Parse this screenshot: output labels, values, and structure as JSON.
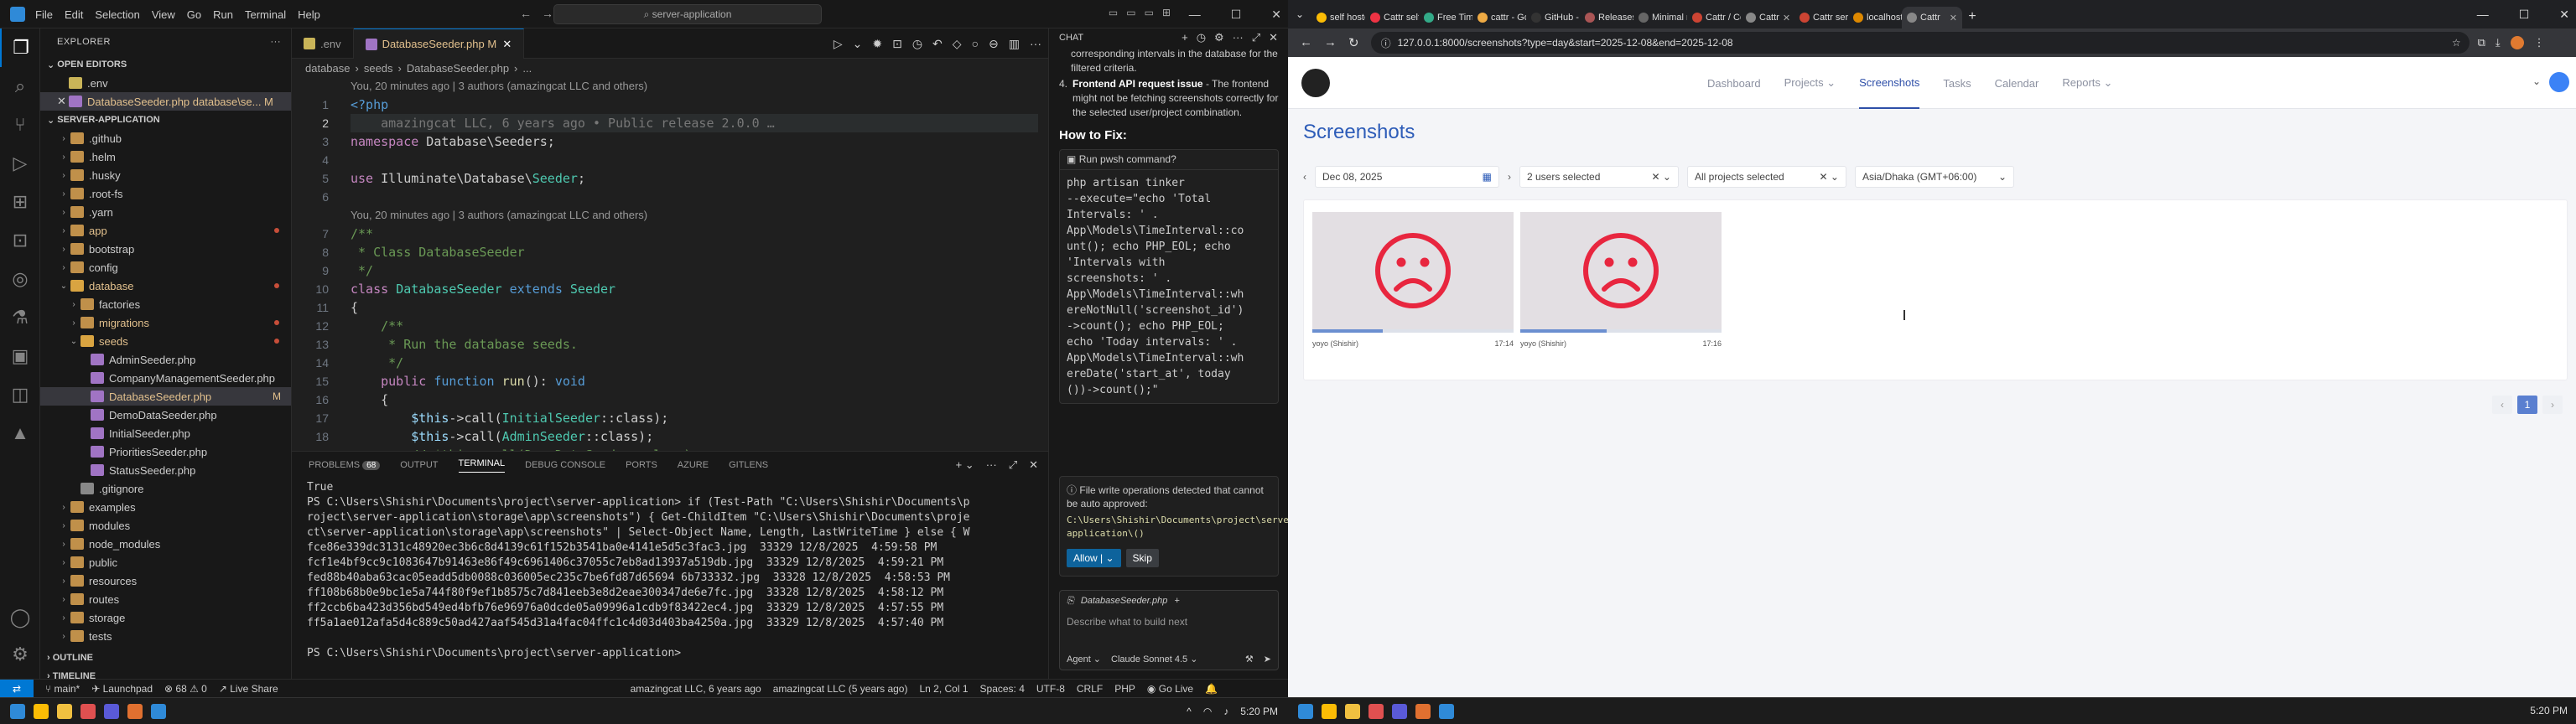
{
  "vscode": {
    "menu": [
      "File",
      "Edit",
      "Selection",
      "View",
      "Go",
      "Run",
      "Terminal",
      "Help"
    ],
    "search": "server-application",
    "explorer_title": "EXPLORER",
    "open_editors": "OPEN EDITORS",
    "open_files": [
      ".env",
      "DatabaseSeeder.php  database\\se...  M"
    ],
    "project": "SERVER-APPLICATION",
    "tree": [
      {
        "label": ".github",
        "depth": 1,
        "type": "folder"
      },
      {
        "label": ".helm",
        "depth": 1,
        "type": "folder"
      },
      {
        "label": ".husky",
        "depth": 1,
        "type": "folder"
      },
      {
        "label": ".root-fs",
        "depth": 1,
        "type": "folder"
      },
      {
        "label": ".yarn",
        "depth": 1,
        "type": "folder"
      },
      {
        "label": "app",
        "depth": 1,
        "type": "folder",
        "mod": true
      },
      {
        "label": "bootstrap",
        "depth": 1,
        "type": "folder"
      },
      {
        "label": "config",
        "depth": 1,
        "type": "folder"
      },
      {
        "label": "database",
        "depth": 1,
        "type": "folder",
        "open": true,
        "mod": true
      },
      {
        "label": "factories",
        "depth": 2,
        "type": "folder"
      },
      {
        "label": "migrations",
        "depth": 2,
        "type": "folder",
        "mod": true
      },
      {
        "label": "seeds",
        "depth": 2,
        "type": "folder",
        "open": true,
        "mod": true
      },
      {
        "label": "AdminSeeder.php",
        "depth": 3,
        "type": "file"
      },
      {
        "label": "CompanyManagementSeeder.php",
        "depth": 3,
        "type": "file"
      },
      {
        "label": "DatabaseSeeder.php",
        "depth": 3,
        "type": "file",
        "mod": true,
        "sel": true,
        "badge": "M"
      },
      {
        "label": "DemoDataSeeder.php",
        "depth": 3,
        "type": "file"
      },
      {
        "label": "InitialSeeder.php",
        "depth": 3,
        "type": "file"
      },
      {
        "label": "PrioritiesSeeder.php",
        "depth": 3,
        "type": "file"
      },
      {
        "label": "StatusSeeder.php",
        "depth": 3,
        "type": "file"
      },
      {
        "label": ".gitignore",
        "depth": 2,
        "type": "file"
      },
      {
        "label": "examples",
        "depth": 1,
        "type": "folder"
      },
      {
        "label": "modules",
        "depth": 1,
        "type": "folder"
      },
      {
        "label": "node_modules",
        "depth": 1,
        "type": "folder"
      },
      {
        "label": "public",
        "depth": 1,
        "type": "folder"
      },
      {
        "label": "resources",
        "depth": 1,
        "type": "folder"
      },
      {
        "label": "routes",
        "depth": 1,
        "type": "folder"
      },
      {
        "label": "storage",
        "depth": 1,
        "type": "folder"
      },
      {
        "label": "tests",
        "depth": 1,
        "type": "folder"
      }
    ],
    "outline": "OUTLINE",
    "timeline": "TIMELINE",
    "tabs": [
      ".env",
      "DatabaseSeeder.php M"
    ],
    "breadcrumb": [
      "database",
      "seeds",
      "DatabaseSeeder.php",
      "..."
    ],
    "code": [
      {
        "n": "",
        "lens": "You, 20 minutes ago | 3 authors (amazingcat LLC and others)"
      },
      {
        "n": "1",
        "t": "<?php"
      },
      {
        "n": "2",
        "t": "    amazingcat LLC, 6 years ago • Public release 2.0.0 …",
        "cur": true
      },
      {
        "n": "3",
        "t": "namespace Database\\Seeders;"
      },
      {
        "n": "4",
        "t": ""
      },
      {
        "n": "5",
        "t": "use Illuminate\\Database\\Seeder;"
      },
      {
        "n": "6",
        "t": ""
      },
      {
        "n": "",
        "lens": "You, 20 minutes ago | 3 authors (amazingcat LLC and others)"
      },
      {
        "n": "7",
        "t": "/**"
      },
      {
        "n": "8",
        "t": " * Class DatabaseSeeder"
      },
      {
        "n": "9",
        "t": " */"
      },
      {
        "n": "10",
        "t": "class DatabaseSeeder extends Seeder"
      },
      {
        "n": "11",
        "t": "{"
      },
      {
        "n": "12",
        "t": "    /**"
      },
      {
        "n": "13",
        "t": "     * Run the database seeds."
      },
      {
        "n": "14",
        "t": "     */"
      },
      {
        "n": "15",
        "t": "    public function run(): void"
      },
      {
        "n": "16",
        "t": "    {"
      },
      {
        "n": "17",
        "t": "        $this->call(InitialSeeder::class);"
      },
      {
        "n": "18",
        "t": "        $this->call(AdminSeeder::class);"
      },
      {
        "n": "19",
        "t": "        // $this->call(DemoDataSeeder::class);"
      }
    ],
    "panel_tabs": [
      "PROBLEMS",
      "OUTPUT",
      "TERMINAL",
      "DEBUG CONSOLE",
      "PORTS",
      "AZURE",
      "GITLENS"
    ],
    "problems_count": "68",
    "terminal": [
      "True",
      "PS C:\\Users\\Shishir\\Documents\\project\\server-application> if (Test-Path \"C:\\Users\\Shishir\\Documents\\p",
      "roject\\server-application\\storage\\app\\screenshots\") { Get-ChildItem \"C:\\Users\\Shishir\\Documents\\proje",
      "ct\\server-application\\storage\\app\\screenshots\" | Select-Object Name, Length, LastWriteTime } else { W",
      "fce86e339dc3131c48920ec3b6c8d4139c61f152b3541ba0e4141e5d5c3fac3.jpg  33329 12/8/2025  4:59:58 PM",
      "fcf1e4bf9cc9c1083647b91463e86f49c6961406c37055c7eb8ad13937a519db.jpg  33329 12/8/2025  4:59:21 PM",
      "fed88b40aba63cac05eadd5db0088c036005ec235c7be6fd87d65694 6b733332.jpg  33328 12/8/2025  4:58:53 PM",
      "ff108b68b0e9bc1e5a744f80f9ef1b8575c7d841eeb3e8d2eae300347de6e7fc.jpg  33328 12/8/2025  4:58:12 PM",
      "ff2ccb6ba423d356bd549ed4bfb76e96976a0dcde05a09996a1cdb9f83422ec4.jpg  33329 12/8/2025  4:57:55 PM",
      "ff5a1ae012afa5d4c889c50ad427aaf545d31a4fac04ffc1c4d03d403ba4250a.jpg  33329 12/8/2025  4:57:40 PM",
      "",
      "PS C:\\Users\\Shishir\\Documents\\project\\server-application> "
    ],
    "chat": {
      "title": "CHAT",
      "intro1": "corresponding intervals in the database for the filtered criteria.",
      "item_num": "4.",
      "item_title": "Frontend API request issue",
      "item_text": " - The frontend might not be fetching screenshots correctly for the selected user/project combination.",
      "howto": "How to Fix:",
      "run_label": "Run  pwsh  command?",
      "command": "php artisan tinker\n--execute=\"echo 'Total\nIntervals: ' .\nApp\\Models\\TimeInterval::co\nunt(); echo PHP_EOL; echo\n'Intervals with\nscreenshots: ' .\nApp\\Models\\TimeInterval::wh\nereNotNull('screenshot_id')\n->count(); echo PHP_EOL;\necho 'Today intervals: ' .\nApp\\Models\\TimeInterval::wh\nereDate('start_at', today\n())->count();\"",
      "warn": "File write operations detected that cannot be auto approved:",
      "warn_path": "C:\\Users\\Shishir\\Documents\\project\\server-application\\()",
      "allow": "Allow",
      "skip": "Skip",
      "attachment": "DatabaseSeeder.php",
      "placeholder": "Describe what to build next",
      "agent": "Agent",
      "model": "Claude Sonnet 4.5"
    },
    "status": {
      "branch": "main*",
      "launchpad": "Launchpad",
      "counts": "⊗ 68  ⚠ 0",
      "live": "Live Share",
      "blame1": "amazingcat LLC, 6 years ago",
      "blame2": "amazingcat LLC (5 years ago)",
      "pos": "Ln 2, Col 1",
      "spaces": "Spaces: 4",
      "enc": "UTF-8",
      "eol": "CRLF",
      "lang": "PHP",
      "golive": "Go Live"
    },
    "clock": "5:20 PM"
  },
  "browser": {
    "tabs": [
      "self hosted",
      "Cattr self ho",
      "Free Time Tr",
      "cattr - Goog",
      "GitHub - catt",
      "Releases · C",
      "Minimal rep",
      "Cattr / Core",
      "Cattr",
      "Cattr server",
      "localhost / ",
      "Cattr"
    ],
    "url": "127.0.0.1:8000/screenshots?type=day&start=2025-12-08&end=2025-12-08",
    "nav": [
      "Dashboard",
      "Projects",
      "Screenshots",
      "Tasks",
      "Calendar",
      "Reports"
    ],
    "title": "Screenshots",
    "date": "Dec 08, 2025",
    "users": "2 users selected",
    "projects": "All projects selected",
    "timezone": "Asia/Dhaka (GMT+06:00)",
    "shots": [
      {
        "user": "yoyo (Shishir)",
        "time": "17:14",
        "progress": 0.35
      },
      {
        "user": "yoyo (Shishir)",
        "time": "17:16",
        "progress": 0.43
      }
    ],
    "page": "1",
    "clock": "5:20 PM"
  }
}
